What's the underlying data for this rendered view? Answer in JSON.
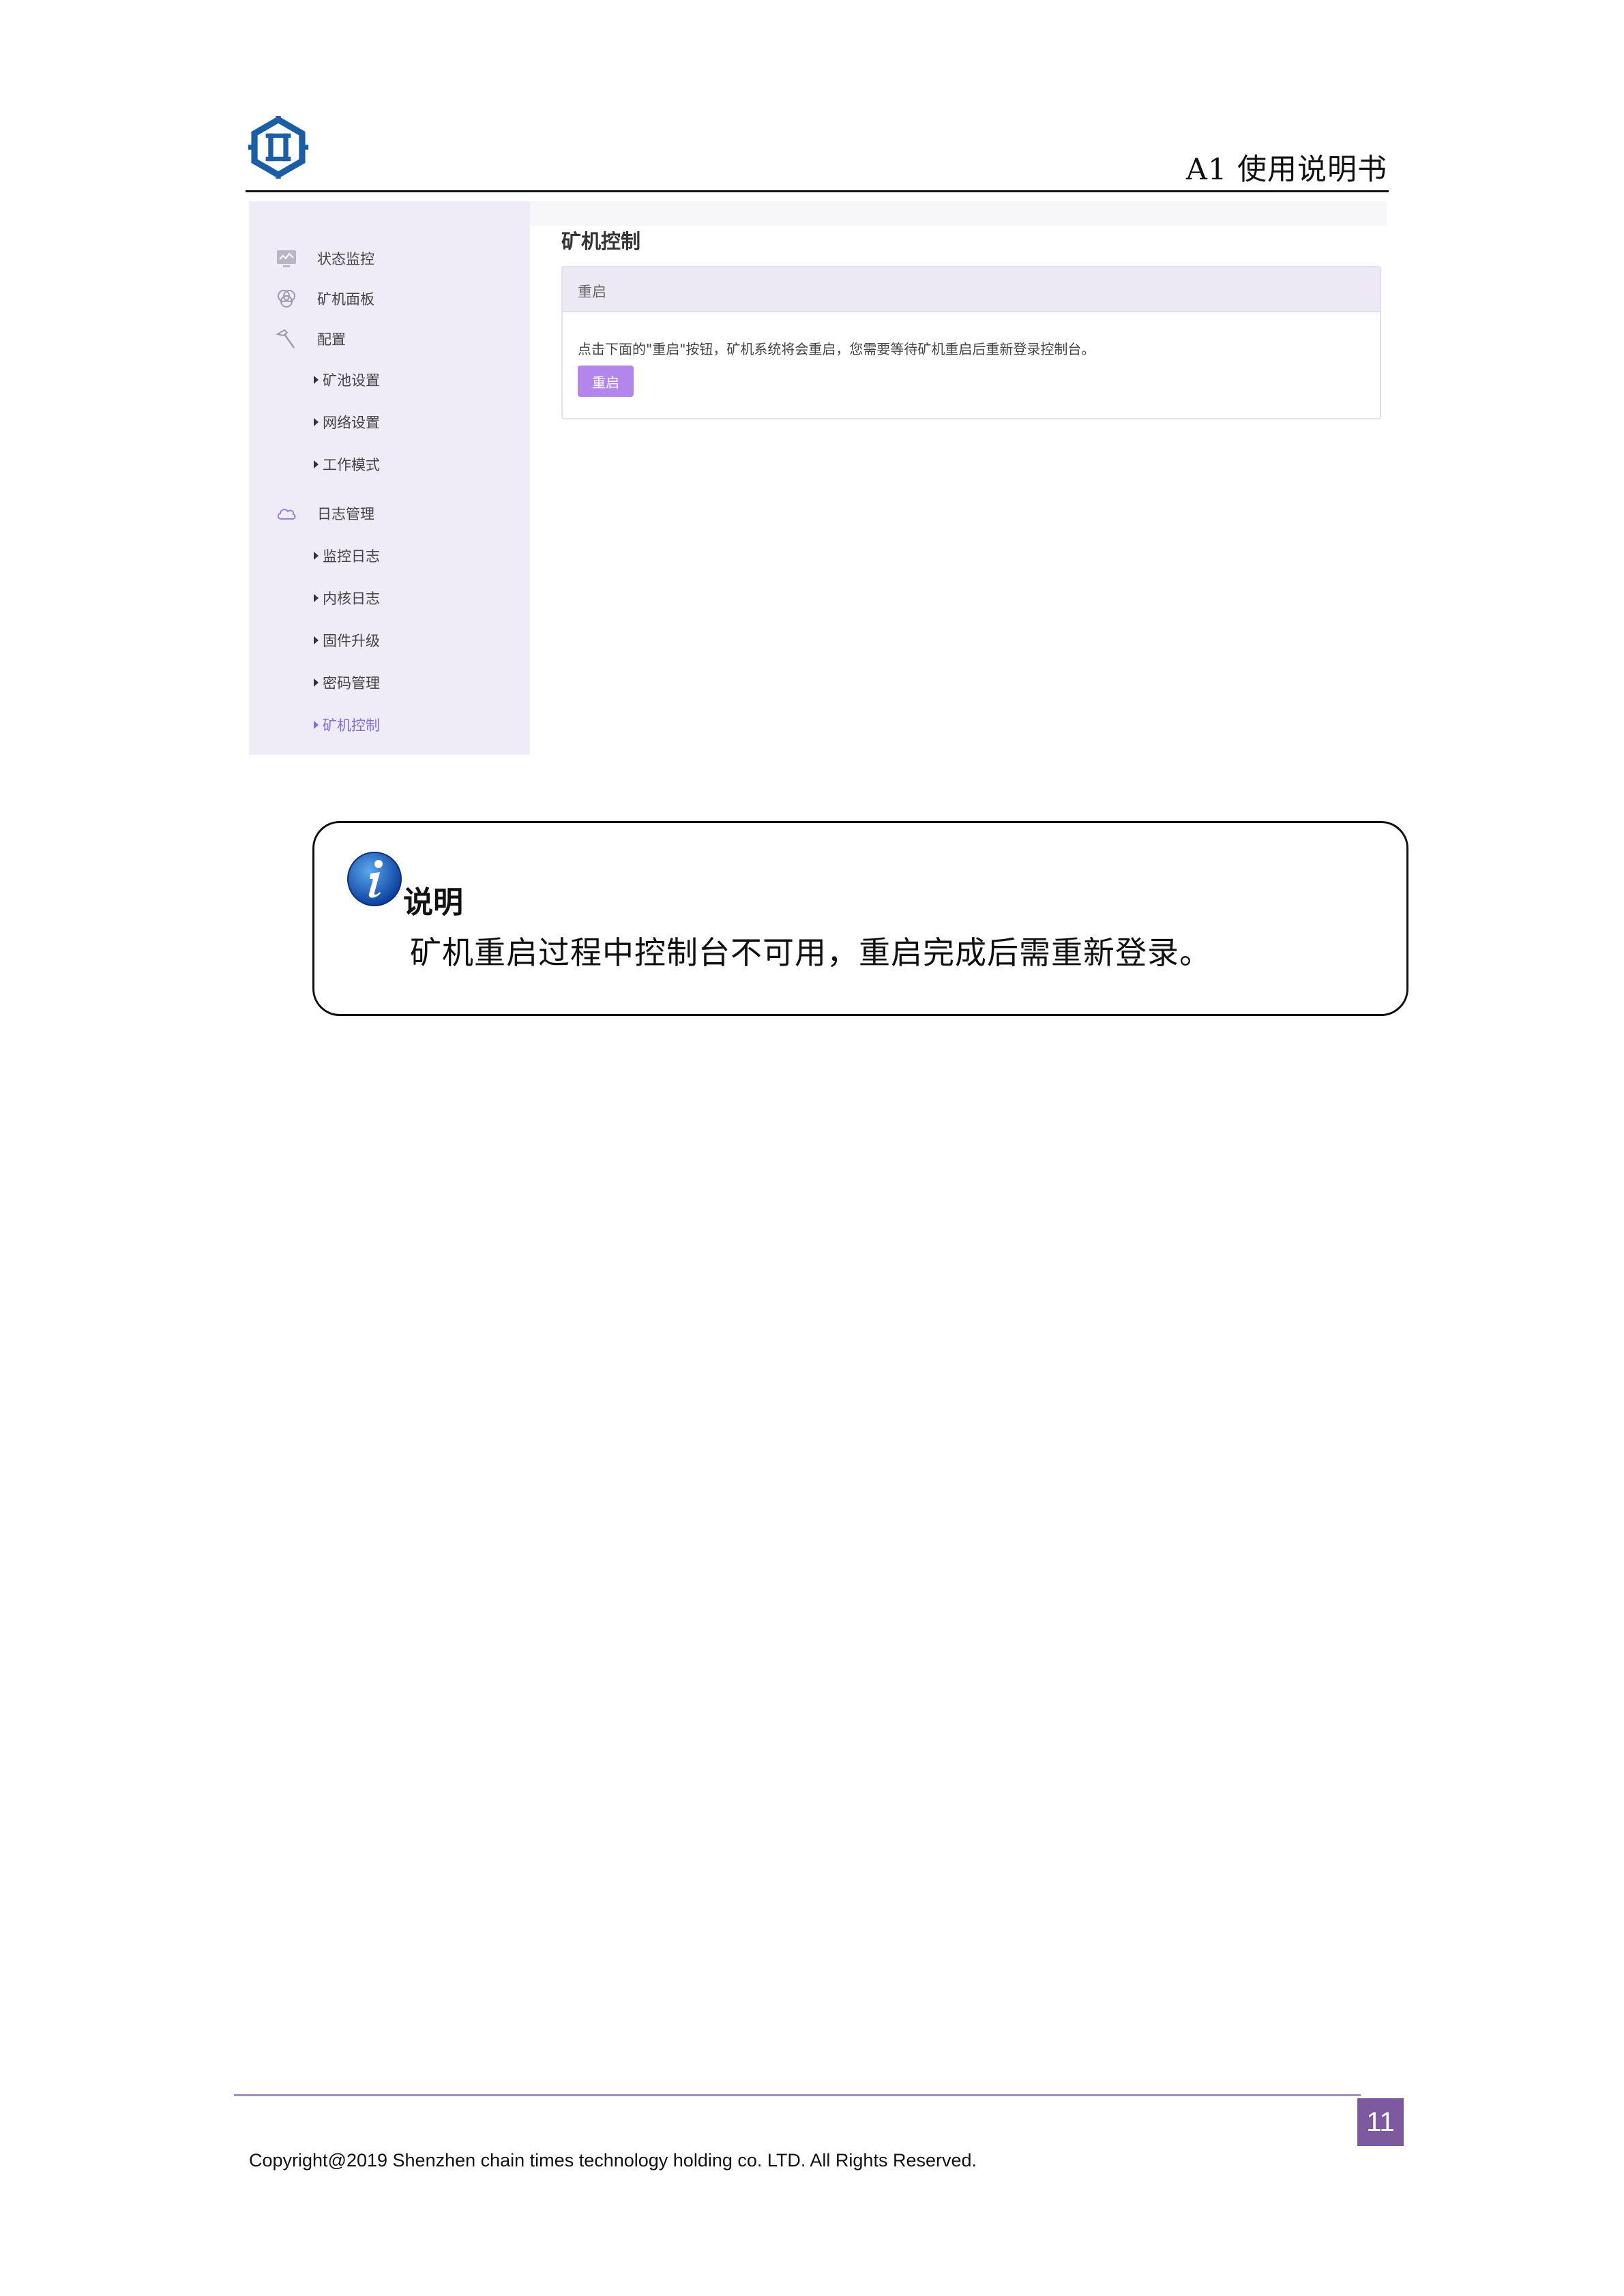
{
  "header": {
    "doc_title": "A1 使用说明书"
  },
  "screenshot": {
    "sidebar": {
      "main_items": [
        {
          "label": "状态监控",
          "icon": "monitor-icon"
        },
        {
          "label": "矿机面板",
          "icon": "panel-icon"
        },
        {
          "label": "配置",
          "icon": "hammer-icon"
        },
        {
          "label": "日志管理",
          "icon": "cloud-icon"
        }
      ],
      "sub_items": [
        {
          "label": "矿池设置"
        },
        {
          "label": "网络设置"
        },
        {
          "label": "工作模式"
        },
        {
          "label": "监控日志"
        },
        {
          "label": "内核日志"
        },
        {
          "label": "固件升级"
        },
        {
          "label": "密码管理"
        },
        {
          "label": "矿机控制"
        }
      ],
      "active": "矿机控制"
    },
    "content": {
      "title": "矿机控制",
      "panel_header": "重启",
      "panel_text": "点击下面的\"重启\"按钮，矿机系统将会重启，您需要等待矿机重启后重新登录控制台。",
      "button_label": "重启",
      "accent_color": "#b286ec"
    }
  },
  "note": {
    "icon": "info-icon",
    "title": "说明",
    "body": "矿机重启过程中控制台不可用，重启完成后需重新登录。"
  },
  "footer": {
    "page_number": "11",
    "copyright": "Copyright@2019 Shenzhen chain times technology holding co. LTD. All Rights Reserved."
  }
}
